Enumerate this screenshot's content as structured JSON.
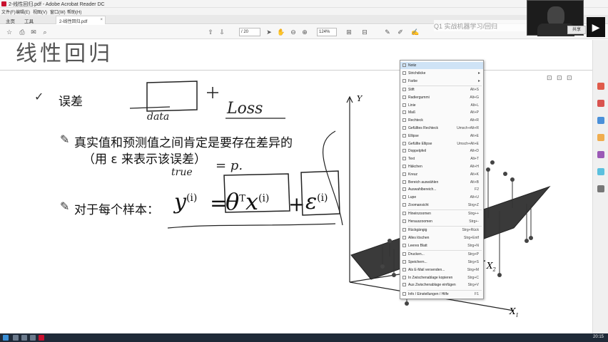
{
  "window": {
    "title": "2-线性回归.pdf - Adobe Acrobat Reader DC"
  },
  "menubar": {
    "items": [
      "文件(F)",
      "编辑(E)",
      "视图(V)",
      "窗口(W)",
      "帮助(H)"
    ]
  },
  "tabs": {
    "home": "主页",
    "tools": "工具",
    "doc": "2-线性回归.pdf"
  },
  "toolbar": {
    "page": "/ 20",
    "zoom": "124%"
  },
  "overlay": {
    "banner": "Q1 实战机器学习/回归",
    "share": "共享"
  },
  "slide": {
    "title": "线性回归",
    "bullet1": "误差",
    "bullet2_line1": "真实值和预测值之间肯定是要存在差异的",
    "bullet2_line2": "（用 ε 来表示该误差）",
    "bullet3": "对于每个样本：",
    "formula": {
      "y": "y",
      "sup_i": "(i)",
      "eq": "=",
      "theta": "θ",
      "T": "T",
      "x": "x",
      "plus": "+",
      "eps": "ε"
    },
    "handwriting": {
      "loss": "Loss",
      "data": "data",
      "true": "true",
      "eq_p": "= p."
    },
    "axes": {
      "y": "Y",
      "x1": "X",
      "x1_sub": "1",
      "x2": "X",
      "x2_sub": "2"
    }
  },
  "context_menu": {
    "items": [
      {
        "label": "Notiz",
        "shortcut": "",
        "hl": true
      },
      {
        "label": "Strichdicke",
        "shortcut": "",
        "sub": true
      },
      {
        "label": "Farbe",
        "shortcut": "",
        "sub": true
      },
      {
        "label": "Stift",
        "shortcut": "Alt+S"
      },
      {
        "label": "Radiergummi",
        "shortcut": "Alt+G"
      },
      {
        "label": "Linie",
        "shortcut": "Alt+L"
      },
      {
        "label": "Maß",
        "shortcut": "Alt+P"
      },
      {
        "label": "Rechteck",
        "shortcut": "Alt+R"
      },
      {
        "label": "Gefülltes Rechteck",
        "shortcut": "Umsch+Alt+R"
      },
      {
        "label": "Ellipse",
        "shortcut": "Alt+E"
      },
      {
        "label": "Gefüllte Ellipse",
        "shortcut": "Umsch+Alt+E"
      },
      {
        "label": "Doppelpfeil",
        "shortcut": "Alt+D"
      },
      {
        "label": "Text",
        "shortcut": "Alt+T"
      },
      {
        "label": "Häkchen",
        "shortcut": "Alt+H"
      },
      {
        "label": "Kreuz",
        "shortcut": "Alt+K"
      },
      {
        "label": "Bereich auswählen",
        "shortcut": "Alt+B"
      },
      {
        "label": "Auswahlbereich...",
        "shortcut": "F2"
      },
      {
        "label": "Lupe",
        "shortcut": "Alt+U"
      },
      {
        "label": "Zoomansicht",
        "shortcut": "Strg+Z"
      },
      {
        "label": "Hineinzoomen",
        "shortcut": "Strg++"
      },
      {
        "label": "Herauszoomen",
        "shortcut": "Strg+-"
      },
      {
        "label": "Rückgängig",
        "shortcut": "Strg+Rück"
      },
      {
        "label": "Alles löschen",
        "shortcut": "Strg+Entf"
      },
      {
        "label": "Leeres Blatt",
        "shortcut": "Strg+N"
      },
      {
        "label": "Drucken...",
        "shortcut": "Strg+P"
      },
      {
        "label": "Speichern...",
        "shortcut": "Strg+S"
      },
      {
        "label": "Als E-Mail versenden...",
        "shortcut": "Strg+M"
      },
      {
        "label": "In Zwischenablage kopieren",
        "shortcut": "Strg+C"
      },
      {
        "label": "Aus Zwischenablage einfügen",
        "shortcut": "Strg+V"
      },
      {
        "label": "Info / Einstellungen / Hilfe",
        "shortcut": "F1"
      }
    ]
  },
  "taskbar": {
    "clock": "20:15"
  },
  "colors": {
    "accent": "#c8102e",
    "menu_highlight": "#cfe3f6",
    "plane": "#3a3a3a"
  }
}
